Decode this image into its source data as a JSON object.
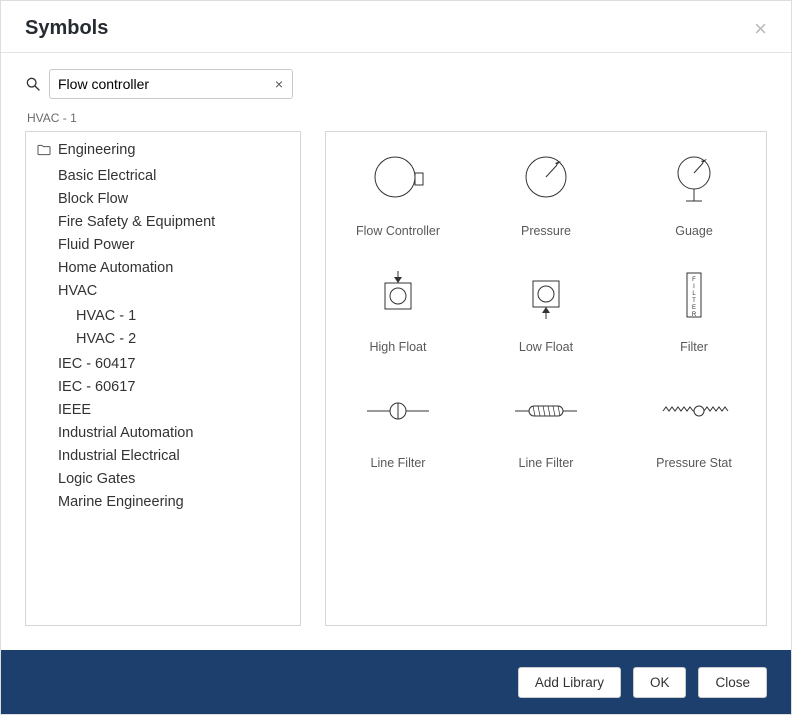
{
  "header": {
    "title": "Symbols"
  },
  "search": {
    "value": "Flow controller"
  },
  "filter_label": "HVAC - 1",
  "tree": {
    "root": "Engineering",
    "items": [
      {
        "label": "Basic Electrical"
      },
      {
        "label": "Block Flow"
      },
      {
        "label": "Fire Safety & Equipment"
      },
      {
        "label": "Fluid Power"
      },
      {
        "label": "Home Automation"
      },
      {
        "label": "HVAC",
        "children": [
          {
            "label": "HVAC - 1"
          },
          {
            "label": "HVAC - 2"
          }
        ]
      },
      {
        "label": "IEC - 60417"
      },
      {
        "label": "IEC - 60617"
      },
      {
        "label": "IEEE"
      },
      {
        "label": "Industrial Automation"
      },
      {
        "label": "Industrial Electrical"
      },
      {
        "label": "Logic Gates"
      },
      {
        "label": "Marine Engineering"
      }
    ]
  },
  "symbols": [
    {
      "label": "Flow Controller",
      "icon": "flow-controller"
    },
    {
      "label": "Pressure",
      "icon": "pressure"
    },
    {
      "label": "Guage",
      "icon": "gauge"
    },
    {
      "label": "High Float",
      "icon": "high-float"
    },
    {
      "label": "Low Float",
      "icon": "low-float"
    },
    {
      "label": "Filter",
      "icon": "filter"
    },
    {
      "label": "Line Filter",
      "icon": "line-filter-round"
    },
    {
      "label": "Line Filter",
      "icon": "line-filter-mesh"
    },
    {
      "label": "Pressure Stat",
      "icon": "pressure-stat"
    }
  ],
  "footer": {
    "add": "Add Library",
    "ok": "OK",
    "close": "Close"
  }
}
